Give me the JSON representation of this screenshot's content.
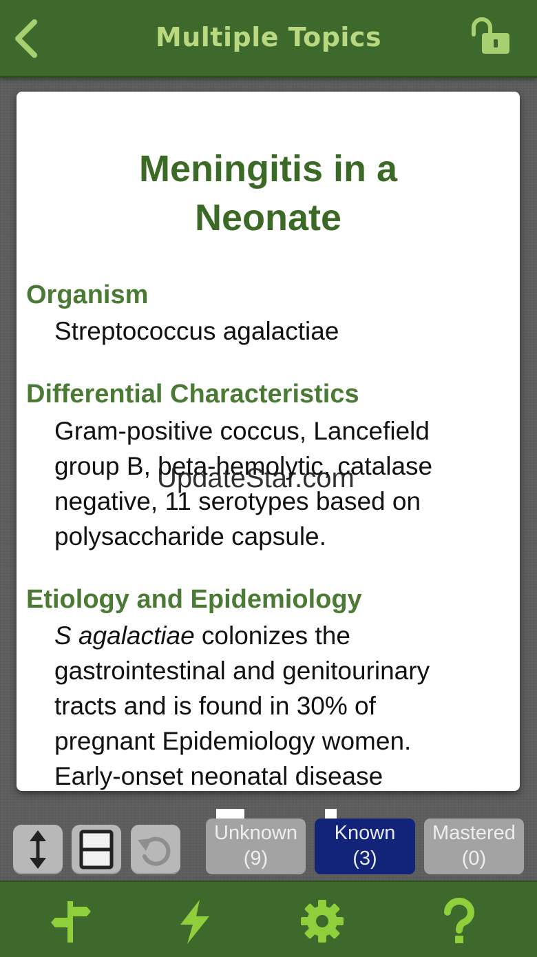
{
  "header": {
    "title": "Multiple Topics",
    "back_icon": "chevron-left-icon",
    "lock_icon": "unlock-icon"
  },
  "card": {
    "title_line1": "Meningitis in a",
    "title_line2": "Neonate",
    "sections": [
      {
        "heading": "Organism",
        "body": [
          "Streptococcus agalactiae"
        ]
      },
      {
        "heading": "Differential Characteristics",
        "body": [
          "Gram-positive coccus, Lancefield",
          "group B, beta-hemolytic, catalase",
          "negative, 11 serotypes based on",
          "polysaccharide capsule."
        ]
      },
      {
        "heading": "Etiology and Epidemiology",
        "body_italic": "S agalactiae",
        "body": [
          " colonizes the",
          "gastrointestinal and genitourinary",
          "tracts and is found in 30% of",
          "pregnant Epidemiology women.",
          "Early-onset neonatal disease"
        ]
      }
    ],
    "watermark": "UpdateStar.com"
  },
  "toolbar": {
    "buttons": [
      "vertical-arrows-icon",
      "split-view-icon",
      "reset-icon"
    ],
    "filters": [
      {
        "label": "Unknown",
        "count": "(9)"
      },
      {
        "label": "Known",
        "count": "(3)"
      },
      {
        "label": "Mastered",
        "count": "(0)"
      }
    ]
  },
  "bottom_nav": [
    "signpost-icon",
    "lightning-icon",
    "gear-icon",
    "help-icon"
  ],
  "colors": {
    "bar_green": "#3d6a2c",
    "title_green": "#b9d880",
    "heading_green": "#4a7a34",
    "active_filter": "#12237a",
    "icon_green": "#8fcf3c"
  }
}
